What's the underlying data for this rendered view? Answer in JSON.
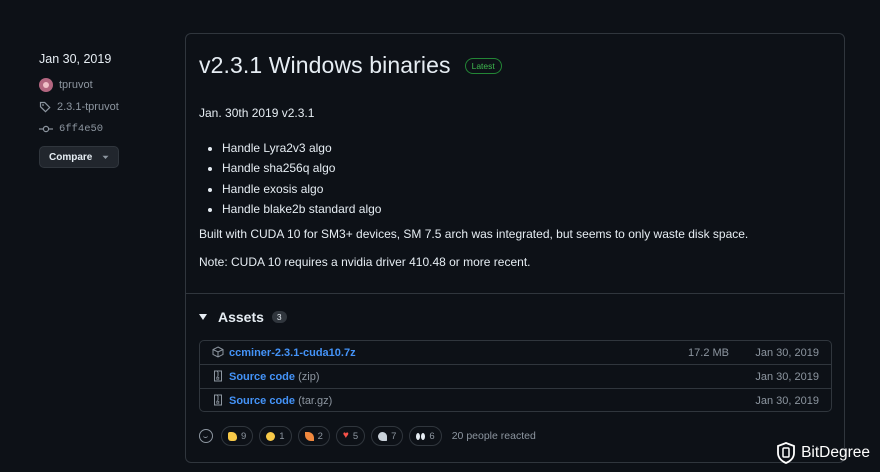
{
  "sidebar": {
    "date": "Jan 30, 2019",
    "author": "tpruvot",
    "tag": "2.3.1-tpruvot",
    "commit": "6ff4e50",
    "compare_label": "Compare"
  },
  "release": {
    "title": "v2.3.1 Windows binaries",
    "badge": "Latest",
    "date_line": "Jan. 30th 2019 v2.3.1",
    "bullets": [
      "Handle Lyra2v3 algo",
      "Handle sha256q algo",
      "Handle exosis algo",
      "Handle blake2b standard algo"
    ],
    "built_line": "Built with CUDA 10 for SM3+ devices, SM 7.5 arch was integrated, but seems to only waste disk space.",
    "note_line": "Note: CUDA 10 requires a nvidia driver 410.48 or more recent."
  },
  "assets": {
    "title": "Assets",
    "count": "3",
    "rows": [
      {
        "name": "ccminer-2.3.1-cuda10.7z",
        "ext": "",
        "size": "17.2 MB",
        "date": "Jan 30, 2019",
        "icon": "package-icon"
      },
      {
        "name": "Source code",
        "ext": "(zip)",
        "size": "",
        "date": "Jan 30, 2019",
        "icon": "file-zip-icon"
      },
      {
        "name": "Source code",
        "ext": "(tar.gz)",
        "size": "",
        "date": "Jan 30, 2019",
        "icon": "file-zip-icon"
      }
    ]
  },
  "reactions": {
    "items": [
      {
        "emoji": "thumbs-up",
        "count": "9",
        "color": "#f7c948"
      },
      {
        "emoji": "laugh",
        "count": "1",
        "color": "#f7c948"
      },
      {
        "emoji": "tada",
        "count": "2",
        "color": "#f0883e"
      },
      {
        "emoji": "heart",
        "count": "5",
        "color": "#f85149"
      },
      {
        "emoji": "rocket",
        "count": "7",
        "color": "#c9d1d9"
      },
      {
        "emoji": "eyes",
        "count": "6",
        "color": "#e6edf3"
      }
    ],
    "summary": "20 people reacted"
  },
  "watermark": {
    "text": "BitDegree"
  },
  "colors": {
    "background": "#0d1117",
    "border": "#30363d",
    "link": "#4493f8",
    "latest": "#3fb950"
  }
}
